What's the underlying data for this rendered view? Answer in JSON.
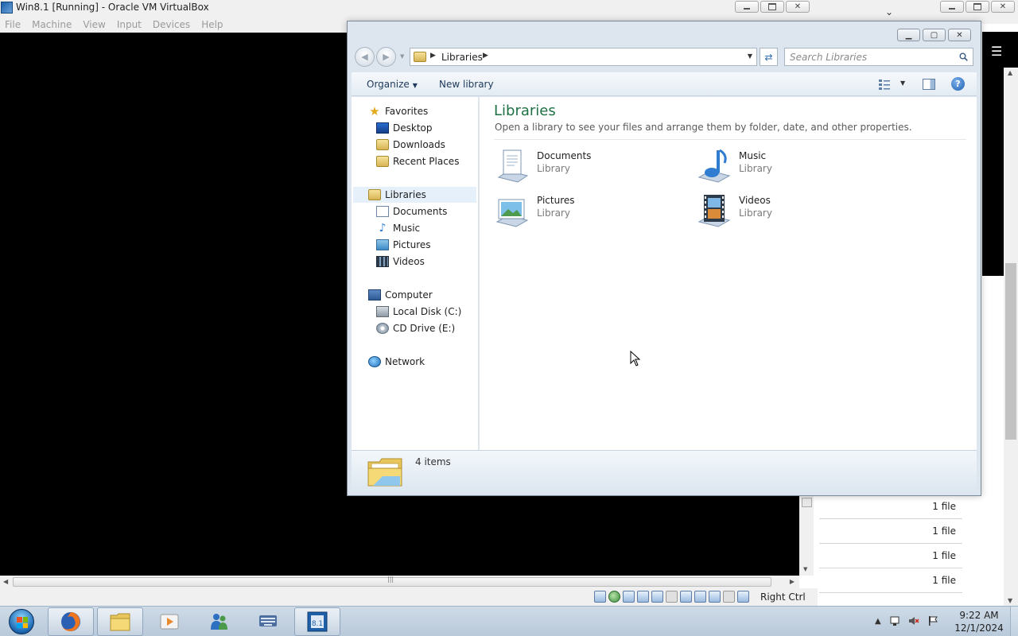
{
  "host": {
    "title": "Win8.1 [Running] - Oracle VM VirtualBox",
    "menu": [
      "File",
      "Machine",
      "View",
      "Input",
      "Devices",
      "Help"
    ],
    "host_key": "Right Ctrl"
  },
  "background_window": {
    "file_rows": [
      "1 file",
      "1 file",
      "1 file",
      "1 file"
    ]
  },
  "explorer": {
    "address": "Libraries",
    "search_placeholder": "Search Libraries",
    "commands": {
      "organize": "Organize",
      "new_library": "New library"
    },
    "nav": {
      "favorites": "Favorites",
      "desktop": "Desktop",
      "downloads": "Downloads",
      "recent": "Recent Places",
      "libraries": "Libraries",
      "documents": "Documents",
      "music": "Music",
      "pictures": "Pictures",
      "videos": "Videos",
      "computer": "Computer",
      "local_disk": "Local Disk (C:)",
      "cd_drive": "CD Drive (E:)",
      "network": "Network"
    },
    "content": {
      "title": "Libraries",
      "description": "Open a library to see your files and arrange them by folder, date, and other properties.",
      "tiles": [
        {
          "name": "Documents",
          "type": "Library"
        },
        {
          "name": "Music",
          "type": "Library"
        },
        {
          "name": "Pictures",
          "type": "Library"
        },
        {
          "name": "Videos",
          "type": "Library"
        }
      ]
    },
    "status": "4 items"
  },
  "taskbar": {
    "badge": "8.1",
    "time": "9:22 AM",
    "date": "12/1/2024"
  },
  "colors": {
    "accent_green": "#1e7145",
    "selection": "#e5f0fb",
    "taskbar": "#c3d3e2"
  }
}
